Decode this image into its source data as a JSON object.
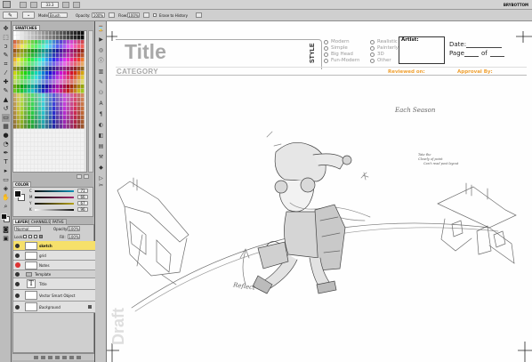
{
  "app": {
    "title": "BRYBOTTOM"
  },
  "menubar": {
    "zoom": "33.3"
  },
  "options": {
    "mode_label": "Mode:",
    "mode_value": "Brush",
    "opacity_label": "Opacity:",
    "opacity_value": "100%",
    "flow_label": "Flow:",
    "flow_value": "100%",
    "erase_to_history": "Erase to History"
  },
  "swatches_panel": {
    "tab": "SWATCHES"
  },
  "color_panel": {
    "tab": "COLOR",
    "sliders": [
      {
        "label": "C",
        "value": "71"
      },
      {
        "label": "M",
        "value": "66"
      },
      {
        "label": "Y",
        "value": "67"
      },
      {
        "label": "K",
        "value": "96"
      }
    ]
  },
  "layers_panel": {
    "tabs": [
      "LAYERS",
      "CHANNELS",
      "PATHS"
    ],
    "blend_mode": "Normal",
    "opacity_label": "Opacity:",
    "opacity_value": "100%",
    "lock_label": "Lock:",
    "fill_label": "Fill:",
    "fill_value": "100%",
    "layers": [
      {
        "name": "sketch",
        "selected": true
      },
      {
        "name": "grid",
        "selected": false
      },
      {
        "name": "Notes",
        "selected": false,
        "red_eye": true
      },
      {
        "name": "Template",
        "selected": false,
        "group": true
      },
      {
        "name": "Title",
        "selected": false,
        "text": true
      },
      {
        "name": "Vector Smart Object",
        "selected": false
      },
      {
        "name": "Background",
        "selected": false,
        "locked": true
      }
    ]
  },
  "template": {
    "title": "Title",
    "category": "CATEGORY",
    "style_label": "STYLE",
    "style_options_left": [
      "Modern",
      "Simple",
      "Big Head",
      "Fun-Modern"
    ],
    "style_options_right": [
      "Realistic",
      "Painterly",
      "3D",
      "Other"
    ],
    "artist_label": "Artist:",
    "date_label": "Date:",
    "page_label": "Page",
    "of_label": "of",
    "reviewed_label": "Reviewed on:",
    "approval_label": "Approval By:",
    "draft_watermark": "Draft"
  },
  "sketch": {
    "caption": "Each Season",
    "note_line1": "Tate the",
    "note_line2": "Clearly of point",
    "note_line3": "Can't read post layout",
    "reflect_note": "Reflect"
  },
  "colors": {
    "accent_orange": "#f0a030",
    "selected_layer": "#f6e06a",
    "workspace": "#4f4f4f",
    "panel": "#b4b4b4"
  }
}
